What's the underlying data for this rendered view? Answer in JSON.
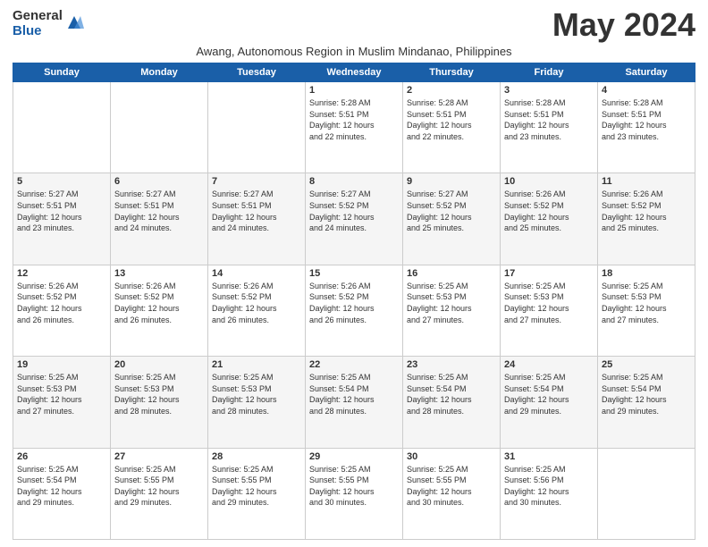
{
  "logo": {
    "general": "General",
    "blue": "Blue"
  },
  "title": "May 2024",
  "subtitle": "Awang, Autonomous Region in Muslim Mindanao, Philippines",
  "days_of_week": [
    "Sunday",
    "Monday",
    "Tuesday",
    "Wednesday",
    "Thursday",
    "Friday",
    "Saturday"
  ],
  "weeks": [
    [
      {
        "day": "",
        "info": ""
      },
      {
        "day": "",
        "info": ""
      },
      {
        "day": "",
        "info": ""
      },
      {
        "day": "1",
        "info": "Sunrise: 5:28 AM\nSunset: 5:51 PM\nDaylight: 12 hours\nand 22 minutes."
      },
      {
        "day": "2",
        "info": "Sunrise: 5:28 AM\nSunset: 5:51 PM\nDaylight: 12 hours\nand 22 minutes."
      },
      {
        "day": "3",
        "info": "Sunrise: 5:28 AM\nSunset: 5:51 PM\nDaylight: 12 hours\nand 23 minutes."
      },
      {
        "day": "4",
        "info": "Sunrise: 5:28 AM\nSunset: 5:51 PM\nDaylight: 12 hours\nand 23 minutes."
      }
    ],
    [
      {
        "day": "5",
        "info": "Sunrise: 5:27 AM\nSunset: 5:51 PM\nDaylight: 12 hours\nand 23 minutes."
      },
      {
        "day": "6",
        "info": "Sunrise: 5:27 AM\nSunset: 5:51 PM\nDaylight: 12 hours\nand 24 minutes."
      },
      {
        "day": "7",
        "info": "Sunrise: 5:27 AM\nSunset: 5:51 PM\nDaylight: 12 hours\nand 24 minutes."
      },
      {
        "day": "8",
        "info": "Sunrise: 5:27 AM\nSunset: 5:52 PM\nDaylight: 12 hours\nand 24 minutes."
      },
      {
        "day": "9",
        "info": "Sunrise: 5:27 AM\nSunset: 5:52 PM\nDaylight: 12 hours\nand 25 minutes."
      },
      {
        "day": "10",
        "info": "Sunrise: 5:26 AM\nSunset: 5:52 PM\nDaylight: 12 hours\nand 25 minutes."
      },
      {
        "day": "11",
        "info": "Sunrise: 5:26 AM\nSunset: 5:52 PM\nDaylight: 12 hours\nand 25 minutes."
      }
    ],
    [
      {
        "day": "12",
        "info": "Sunrise: 5:26 AM\nSunset: 5:52 PM\nDaylight: 12 hours\nand 26 minutes."
      },
      {
        "day": "13",
        "info": "Sunrise: 5:26 AM\nSunset: 5:52 PM\nDaylight: 12 hours\nand 26 minutes."
      },
      {
        "day": "14",
        "info": "Sunrise: 5:26 AM\nSunset: 5:52 PM\nDaylight: 12 hours\nand 26 minutes."
      },
      {
        "day": "15",
        "info": "Sunrise: 5:26 AM\nSunset: 5:52 PM\nDaylight: 12 hours\nand 26 minutes."
      },
      {
        "day": "16",
        "info": "Sunrise: 5:25 AM\nSunset: 5:53 PM\nDaylight: 12 hours\nand 27 minutes."
      },
      {
        "day": "17",
        "info": "Sunrise: 5:25 AM\nSunset: 5:53 PM\nDaylight: 12 hours\nand 27 minutes."
      },
      {
        "day": "18",
        "info": "Sunrise: 5:25 AM\nSunset: 5:53 PM\nDaylight: 12 hours\nand 27 minutes."
      }
    ],
    [
      {
        "day": "19",
        "info": "Sunrise: 5:25 AM\nSunset: 5:53 PM\nDaylight: 12 hours\nand 27 minutes."
      },
      {
        "day": "20",
        "info": "Sunrise: 5:25 AM\nSunset: 5:53 PM\nDaylight: 12 hours\nand 28 minutes."
      },
      {
        "day": "21",
        "info": "Sunrise: 5:25 AM\nSunset: 5:53 PM\nDaylight: 12 hours\nand 28 minutes."
      },
      {
        "day": "22",
        "info": "Sunrise: 5:25 AM\nSunset: 5:54 PM\nDaylight: 12 hours\nand 28 minutes."
      },
      {
        "day": "23",
        "info": "Sunrise: 5:25 AM\nSunset: 5:54 PM\nDaylight: 12 hours\nand 28 minutes."
      },
      {
        "day": "24",
        "info": "Sunrise: 5:25 AM\nSunset: 5:54 PM\nDaylight: 12 hours\nand 29 minutes."
      },
      {
        "day": "25",
        "info": "Sunrise: 5:25 AM\nSunset: 5:54 PM\nDaylight: 12 hours\nand 29 minutes."
      }
    ],
    [
      {
        "day": "26",
        "info": "Sunrise: 5:25 AM\nSunset: 5:54 PM\nDaylight: 12 hours\nand 29 minutes."
      },
      {
        "day": "27",
        "info": "Sunrise: 5:25 AM\nSunset: 5:55 PM\nDaylight: 12 hours\nand 29 minutes."
      },
      {
        "day": "28",
        "info": "Sunrise: 5:25 AM\nSunset: 5:55 PM\nDaylight: 12 hours\nand 29 minutes."
      },
      {
        "day": "29",
        "info": "Sunrise: 5:25 AM\nSunset: 5:55 PM\nDaylight: 12 hours\nand 30 minutes."
      },
      {
        "day": "30",
        "info": "Sunrise: 5:25 AM\nSunset: 5:55 PM\nDaylight: 12 hours\nand 30 minutes."
      },
      {
        "day": "31",
        "info": "Sunrise: 5:25 AM\nSunset: 5:56 PM\nDaylight: 12 hours\nand 30 minutes."
      },
      {
        "day": "",
        "info": ""
      }
    ]
  ]
}
